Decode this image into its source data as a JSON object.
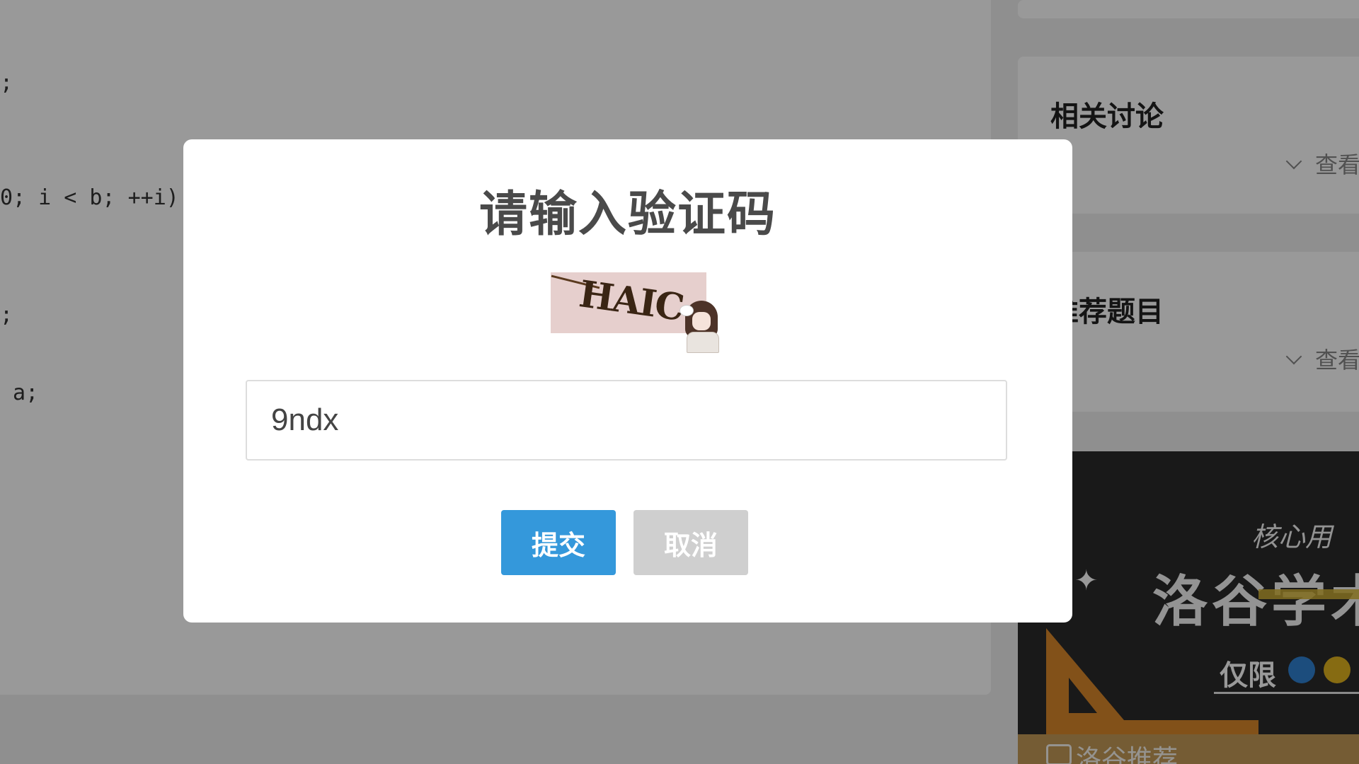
{
  "background": {
    "code_lines": [
      ";",
      "0; i < b; ++i)",
      ";",
      " a;"
    ],
    "side_cards": [
      {
        "title": "相关讨论",
        "more": "查看"
      },
      {
        "title": "推荐题目",
        "more": "查看"
      }
    ],
    "promo": {
      "core_text": "核心用",
      "brand_text": "洛谷学术",
      "limit_text": "仅限",
      "footer_label": "洛谷推荐",
      "colors": {
        "badge_blue": "#2f80d1",
        "badge_gold": "#e0b21f",
        "accent": "#d9872b"
      }
    }
  },
  "dialog": {
    "title": "请输入验证码",
    "captcha_text": "HAIC",
    "input_value": "9ndx",
    "submit_label": "提交",
    "cancel_label": "取消",
    "colors": {
      "submit": "#3498db",
      "cancel": "#cfcfcf",
      "title": "#4a4a4a"
    }
  }
}
